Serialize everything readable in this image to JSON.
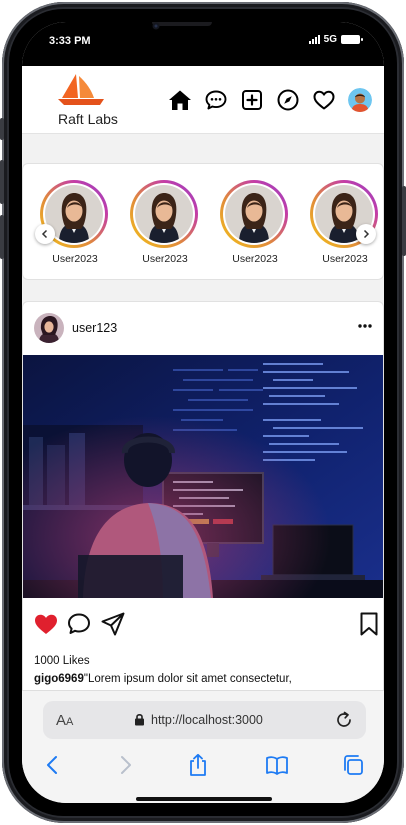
{
  "status_bar": {
    "time": "3:33 PM",
    "network": "5G"
  },
  "app": {
    "brand": "Raft Labs",
    "nav": [
      {
        "name": "home-icon",
        "label": "Home"
      },
      {
        "name": "messages-icon",
        "label": "Messages"
      },
      {
        "name": "create-icon",
        "label": "Create"
      },
      {
        "name": "explore-icon",
        "label": "Explore"
      },
      {
        "name": "likes-icon",
        "label": "Activity"
      },
      {
        "name": "profile-avatar",
        "label": "Profile"
      }
    ]
  },
  "stories": {
    "items": [
      {
        "username": "User2023"
      },
      {
        "username": "User2023"
      },
      {
        "username": "User2023"
      },
      {
        "username": "User2023"
      }
    ],
    "prev_icon": "chevron-left-icon",
    "next_icon": "chevron-right-icon"
  },
  "post": {
    "username": "user123",
    "more_icon": "more-dots-icon",
    "likes": "1000 Likes",
    "caption_user": "gigo6969",
    "caption_text": "\"Lorem ipsum dolor sit amet consectetur,",
    "liked": true,
    "colors": {
      "like": "#e0202e"
    }
  },
  "browser": {
    "text_size_label_big": "A",
    "text_size_label_small": "A",
    "url": "http://localhost:3000",
    "accent": "#1e7bf3"
  }
}
